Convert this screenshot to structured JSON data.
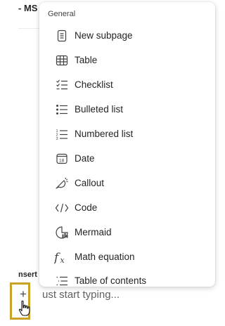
{
  "background": {
    "title_fragment": "- MS",
    "insert_label": "nsert",
    "plus_glyph": "+",
    "placeholder": "ust start typing..."
  },
  "menu": {
    "header": "General",
    "items": [
      {
        "label": "New subpage",
        "icon": "page-icon"
      },
      {
        "label": "Table",
        "icon": "table-icon"
      },
      {
        "label": "Checklist",
        "icon": "checklist-icon"
      },
      {
        "label": "Bulleted list",
        "icon": "bulleted-list-icon"
      },
      {
        "label": "Numbered list",
        "icon": "numbered-list-icon"
      },
      {
        "label": "Date",
        "icon": "calendar-icon"
      },
      {
        "label": "Callout",
        "icon": "callout-icon"
      },
      {
        "label": "Code",
        "icon": "code-icon"
      },
      {
        "label": "Mermaid",
        "icon": "mermaid-icon"
      },
      {
        "label": "Math equation",
        "icon": "math-icon"
      },
      {
        "label": "Table of contents",
        "icon": "table-of-contents-icon"
      }
    ]
  },
  "colors": {
    "highlight_border": "#c9a227",
    "text": "#242424",
    "icon": "#424242"
  }
}
